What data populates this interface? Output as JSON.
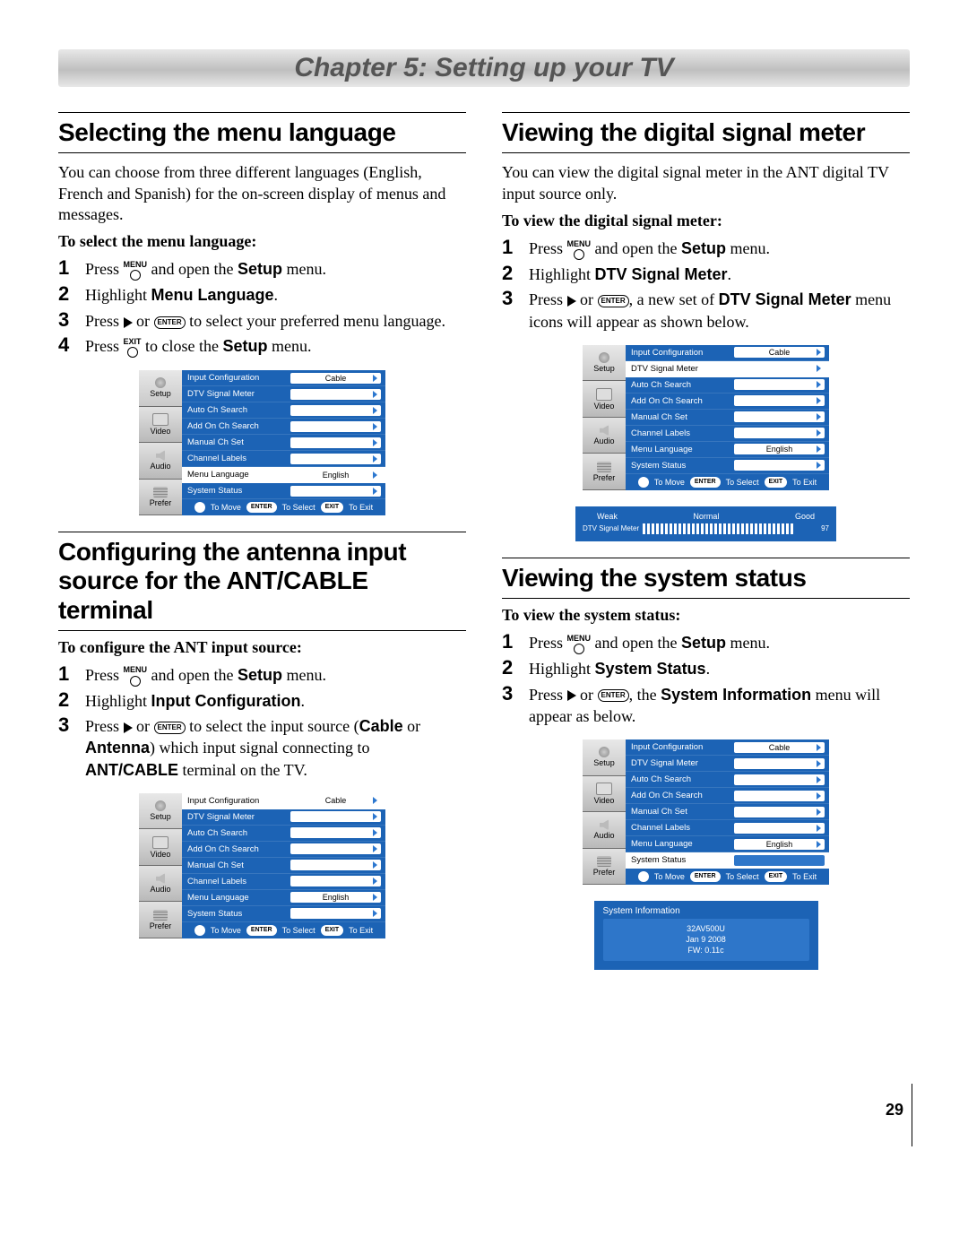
{
  "chapter_title": "Chapter 5: Setting up your TV",
  "page_number": "29",
  "buttons": {
    "menu": "MENU",
    "exit": "EXIT",
    "enter": "ENTER"
  },
  "sections": {
    "menu_lang": {
      "title": "Selecting the menu language",
      "intro": "You can choose from three different languages (English, French and Spanish) for the on-screen display of menus and messages.",
      "lead": "To select the menu language:",
      "steps": {
        "s1a": "Press ",
        "s1b": " and open the ",
        "s1c": "Setup",
        "s1d": " menu.",
        "s2a": "Highlight ",
        "s2b": "Menu Language",
        "s2c": ".",
        "s3a": "Press ",
        "s3b": " or ",
        "s3c": " to select your preferred menu language.",
        "s4a": "Press ",
        "s4b": " to close the ",
        "s4c": "Setup",
        "s4d": " menu."
      }
    },
    "ant": {
      "title": "Configuring the antenna input source for the ANT/CABLE terminal",
      "lead": "To configure the ANT input source:",
      "steps": {
        "s1a": "Press ",
        "s1b": " and open the ",
        "s1c": "Setup",
        "s1d": " menu.",
        "s2a": "Highlight ",
        "s2b": "Input Configuration",
        "s2c": ".",
        "s3a": "Press ",
        "s3b": " or ",
        "s3c": " to select the input source (",
        "s3d": "Cable",
        "s3e": " or ",
        "s3f": "Antenna",
        "s3g": ") which input signal connecting to ",
        "s3h": "ANT/CABLE",
        "s3i": " terminal on the TV."
      }
    },
    "dsm": {
      "title": "Viewing the digital signal meter",
      "intro": "You can view the digital signal meter in the ANT digital TV input source only.",
      "lead": "To view the digital signal meter:",
      "steps": {
        "s1a": "Press ",
        "s1b": " and open the ",
        "s1c": "Setup",
        "s1d": " menu.",
        "s2a": "Highlight ",
        "s2b": "DTV Signal Meter",
        "s2c": ".",
        "s3a": "Press ",
        "s3b": " or ",
        "s3c": ", a new set of ",
        "s3d": "DTV Signal Meter",
        "s3e": " menu icons will appear as shown below."
      },
      "signal": {
        "weak": "Weak",
        "normal": "Normal",
        "good": "Good",
        "label": "DTV Signal Meter",
        "value": "97"
      }
    },
    "status": {
      "title": "Viewing the system status",
      "lead": "To view the system status:",
      "steps": {
        "s1a": "Press ",
        "s1b": " and open the ",
        "s1c": "Setup",
        "s1d": " menu.",
        "s2a": "Highlight ",
        "s2b": "System Status",
        "s2c": ".",
        "s3a": "Press ",
        "s3b": " or ",
        "s3c": ", the ",
        "s3d": "System Information",
        "s3e": " menu will appear as below."
      },
      "sysinfo": {
        "heading": "System Information",
        "model": "32AV500U",
        "date": "Jan  9  2008",
        "fw": "FW: 0.11c"
      }
    }
  },
  "osd": {
    "tabs": {
      "setup": "Setup",
      "video": "Video",
      "audio": "Audio",
      "prefer": "Prefer"
    },
    "rows": {
      "input_cfg": "Input Configuration",
      "dtv": "DTV Signal Meter",
      "auto": "Auto Ch Search",
      "addon": "Add On Ch Search",
      "manual": "Manual Ch Set",
      "labels": "Channel Labels",
      "menulang": "Menu Language",
      "status": "System Status"
    },
    "values": {
      "cable": "Cable",
      "english": "English"
    },
    "footer": {
      "move": "To Move",
      "enter": "ENTER",
      "select": "To Select",
      "exit": "EXIT",
      "toexit": "To Exit"
    }
  }
}
